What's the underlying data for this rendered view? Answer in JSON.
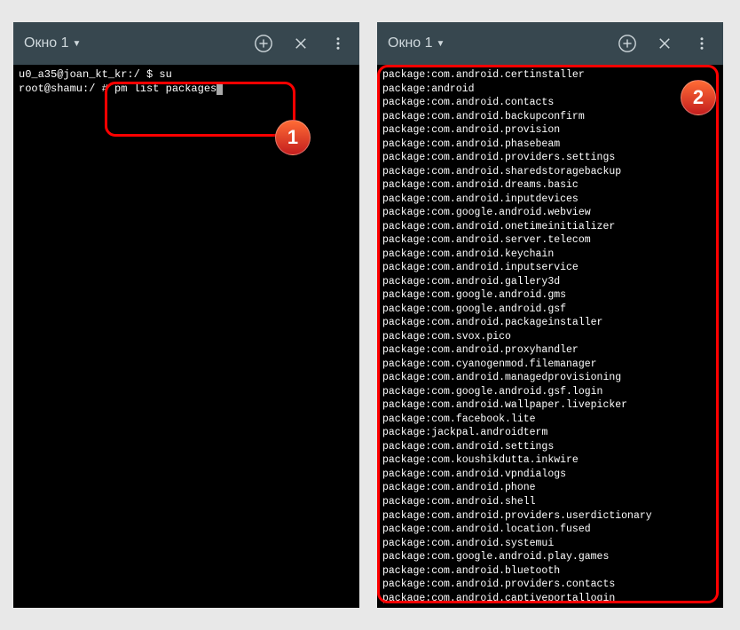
{
  "left": {
    "header": {
      "title": "Окно 1",
      "add_icon": "⊕",
      "close_icon": "✕",
      "menu_icon": "⋮"
    },
    "lines": [
      "u0_a35@joan_kt_kr:/ $ su",
      "root@shamu:/ # pm list packages"
    ],
    "badge": "1"
  },
  "right": {
    "header": {
      "title": "Окно 1",
      "add_icon": "⊕",
      "close_icon": "✕",
      "menu_icon": "⋮"
    },
    "packages": [
      "package:com.android.certinstaller",
      "package:android",
      "package:com.android.contacts",
      "package:com.android.backupconfirm",
      "package:com.android.provision",
      "package:com.android.phasebeam",
      "package:com.android.providers.settings",
      "package:com.android.sharedstoragebackup",
      "package:com.android.dreams.basic",
      "package:com.android.inputdevices",
      "package:com.google.android.webview",
      "package:com.android.onetimeinitializer",
      "package:com.android.server.telecom",
      "package:com.android.keychain",
      "package:com.android.inputservice",
      "package:com.android.gallery3d",
      "package:com.google.android.gms",
      "package:com.google.android.gsf",
      "package:com.android.packageinstaller",
      "package:com.svox.pico",
      "package:com.android.proxyhandler",
      "package:com.cyanogenmod.filemanager",
      "package:com.android.managedprovisioning",
      "package:com.google.android.gsf.login",
      "package:com.android.wallpaper.livepicker",
      "package:com.facebook.lite",
      "package:jackpal.androidterm",
      "package:com.android.settings",
      "package:com.koushikdutta.inkwire",
      "package:com.android.vpndialogs",
      "package:com.android.phone",
      "package:com.android.shell",
      "package:com.android.providers.userdictionary",
      "package:com.android.location.fused",
      "package:com.android.systemui",
      "package:com.google.android.play.games",
      "package:com.android.bluetooth",
      "package:com.android.providers.contacts",
      "package:com.android.captiveportallogin"
    ],
    "badge": "2"
  }
}
